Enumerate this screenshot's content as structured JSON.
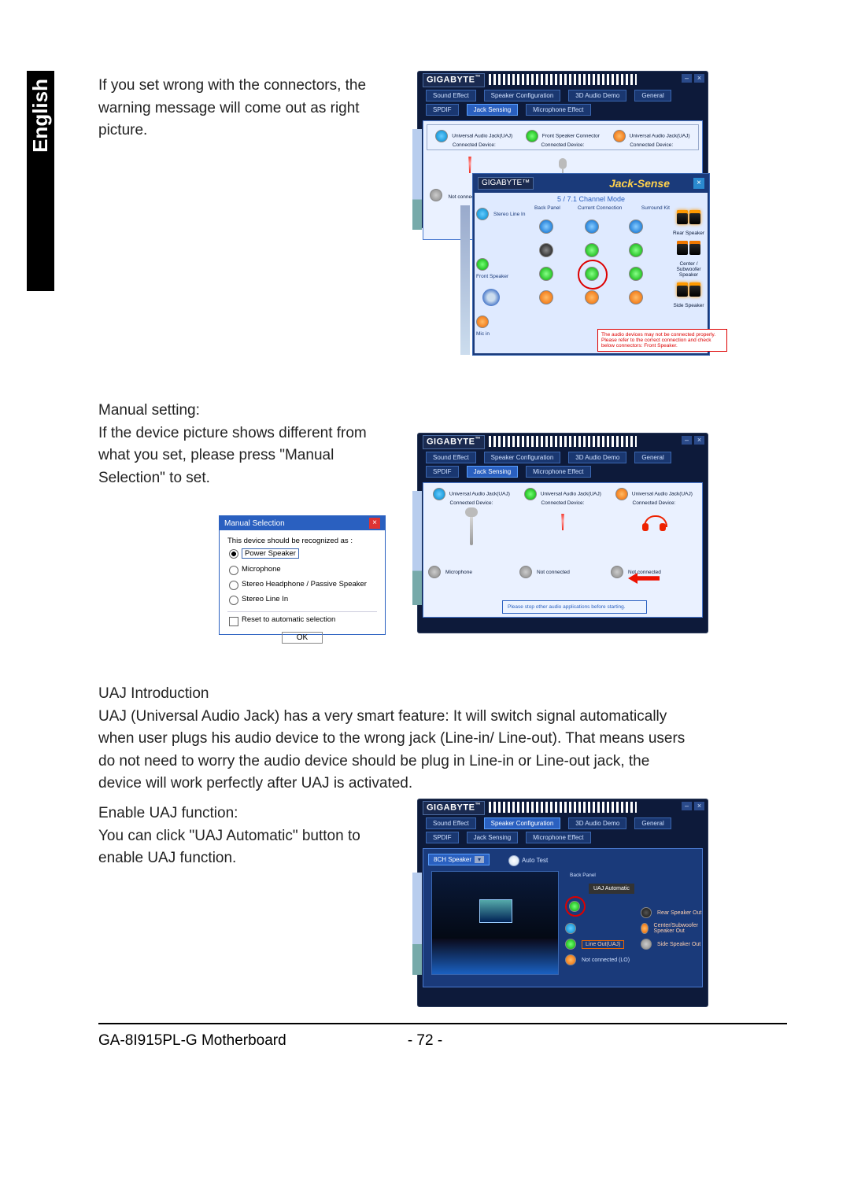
{
  "sidebar": {
    "language": "English"
  },
  "section1": {
    "text": "If you set wrong with the connectors, the warning message will come out as right picture."
  },
  "section2": {
    "label": "Manual setting:",
    "text": "If the device picture shows different from what you set, please press \"Manual Selection\" to set."
  },
  "section3": {
    "title": "UAJ Introduction",
    "text": "UAJ (Universal Audio Jack) has a very smart feature: It will switch signal automatically when user plugs his audio device to the wrong jack (Line-in/ Line-out). That means users do not need to worry the audio device should be plug in Line-in or Line-out jack, the device will work perfectly after UAJ is activated."
  },
  "section4": {
    "label": "Enable UAJ function:",
    "text": "You can click \"UAJ Automatic\" button to enable UAJ function."
  },
  "app": {
    "brand": "GIGABYTE",
    "tabs": {
      "sound_effect": "Sound Effect",
      "speaker_config": "Speaker Configuration",
      "audio_demo": "3D Audio Demo",
      "general": "General",
      "spdif": "SPDIF",
      "jack_sensing": "Jack Sensing",
      "mic_effect": "Microphone Effect"
    },
    "uaj_label": "Universal Audio Jack(UAJ)",
    "front_speaker_connector": "Front Speaker Connector",
    "connected_device": "Connected Device:",
    "not_connected": "Not connected"
  },
  "jack_sense": {
    "title": "Jack-Sense",
    "mode": "5 / 7.1 Channel Mode",
    "labels": {
      "back_panel": "Back Panel",
      "current_connection": "Current Connection",
      "surround_kit": "Surround Kit",
      "stereo_line_in": "Stereo Line In",
      "front_speaker": "Front Speaker",
      "mic_in": "Mic in",
      "rear_speaker": "Rear Speaker",
      "center_sub": "Center / Subwoofer Speaker",
      "side_speaker": "Side Speaker"
    },
    "warning": "The audio devices may not be connected properly. Please refer to the correct connection and check below connectors: Front Speaker."
  },
  "manual_selection": {
    "title": "Manual Selection",
    "prompt": "This device should be recognized as :",
    "options": {
      "power_speaker": "Power Speaker",
      "microphone": "Microphone",
      "headphone": "Stereo Headphone / Passive Speaker",
      "line_in": "Stereo Line In"
    },
    "reset": "Reset to automatic selection",
    "ok": "OK"
  },
  "fig2": {
    "microphone": "Microphone",
    "not_connected": "Not connected",
    "stop_apps": "Please stop other audio applications before starting."
  },
  "fig3": {
    "speaker_mode": "8CH Speaker",
    "auto_test": "Auto Test",
    "back_panel": "Back Panel",
    "uaj_auto": "UAJ Automatic",
    "line_out": "Line Out(UAJ)",
    "not_connected_lo": "Not connected (LO)",
    "rear_speaker_out": "Rear Speaker Out",
    "center_sub_out": "Center/Subwoofer Speaker Out",
    "side_speaker_out": "Side Speaker Out"
  },
  "footer": {
    "model": "GA-8I915PL-G Motherboard",
    "page": "- 72 -"
  }
}
